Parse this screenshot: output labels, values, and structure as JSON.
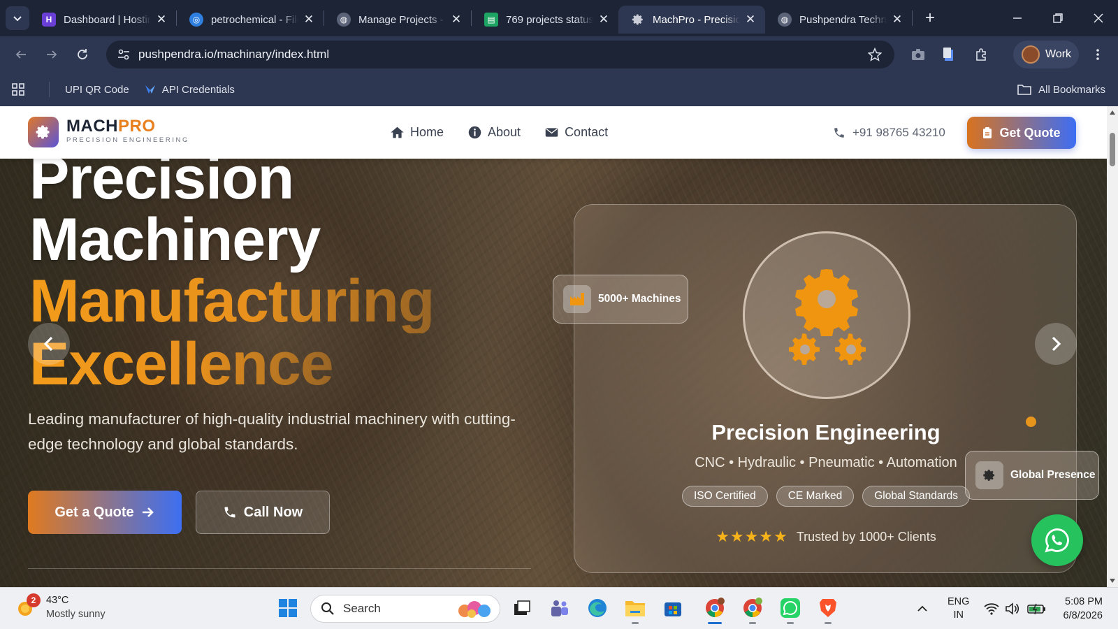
{
  "browser": {
    "tabs": [
      {
        "title": "Dashboard | Hosting",
        "icon": "hosting-dashboard-icon",
        "color": "#6a3fd6",
        "active": false
      },
      {
        "title": "petrochemical - Files",
        "icon": "globe-blue-icon",
        "color": "#2f7fe0",
        "active": false
      },
      {
        "title": "Manage Projects - ",
        "icon": "globe-icon",
        "color": "#8b92a3",
        "active": false
      },
      {
        "title": "769 projects status",
        "icon": "sheets-icon",
        "color": "#1da462",
        "active": false
      },
      {
        "title": "MachPro - Precision",
        "icon": "gear-icon",
        "color": "#c9ccd6",
        "active": true
      },
      {
        "title": "Pushpendra Technologies",
        "icon": "globe-icon",
        "color": "#8b92a3",
        "active": false
      }
    ],
    "url": "pushpendra.io/machinary/index.html",
    "profile_label": "Work",
    "bookmarks": [
      {
        "label": "UPI QR Code"
      },
      {
        "label": "API Credentials"
      }
    ],
    "all_bookmarks_label": "All Bookmarks"
  },
  "site": {
    "brand_main": "MACH",
    "brand_accent": "PRO",
    "tagline": "PRECISION ENGINEERING",
    "nav": [
      {
        "label": "Home",
        "icon": "home-icon"
      },
      {
        "label": "About",
        "icon": "info-icon"
      },
      {
        "label": "Contact",
        "icon": "envelope-icon"
      }
    ],
    "phone": "+91 98765 43210",
    "get_quote_label": "Get Quote",
    "accent_colors": {
      "orange": "#e8801f",
      "blue": "#3e6ef3",
      "whatsapp": "#26c25d"
    }
  },
  "hero": {
    "line1": "Precision",
    "line2": "Machinery",
    "line3": "Manufacturing",
    "line4": "Excellence",
    "subtitle": "Leading manufacturer of high-quality industrial machinery with cutting-edge technology and global standards.",
    "primary_button": "Get a Quote",
    "secondary_button": "Call Now"
  },
  "card": {
    "title": "Precision Engineering",
    "subtitle": "CNC • Hydraulic • Pneumatic • Automation",
    "pills": [
      "ISO Certified",
      "CE Marked",
      "Global Standards"
    ],
    "stars": "★★★★★",
    "rating_text": "Trusted by 1000+ Clients",
    "badge_machines": "5000+ Machines",
    "badge_global": "Global Presence"
  },
  "taskbar": {
    "weather_temp": "43°C",
    "weather_desc": "Mostly sunny",
    "weather_badge": "2",
    "search_placeholder": "Search",
    "lang_top": "ENG",
    "lang_bottom": "IN",
    "time": "5:08 PM",
    "date": "6/8/2026"
  }
}
